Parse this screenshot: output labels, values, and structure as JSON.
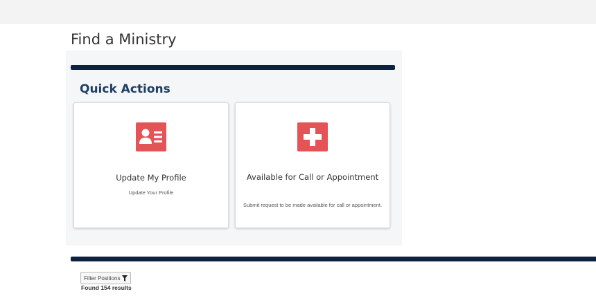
{
  "page": {
    "title": "Find a Ministry"
  },
  "quick_actions": {
    "heading": "Quick Actions",
    "accent_color": "#0d2240",
    "icon_color": "#e45355",
    "cards": [
      {
        "title": "Update My Profile",
        "subtitle": "Update Your Profile",
        "icon": "profile-card-icon"
      },
      {
        "title": "Available for Call or Appointment",
        "subtitle": "Submit request to be made available for call or appointment.",
        "icon": "plus-icon"
      }
    ]
  },
  "results": {
    "filter_label": "Filter Positions",
    "filter_icon": "filter-icon",
    "count_text": "Found 154 results"
  }
}
